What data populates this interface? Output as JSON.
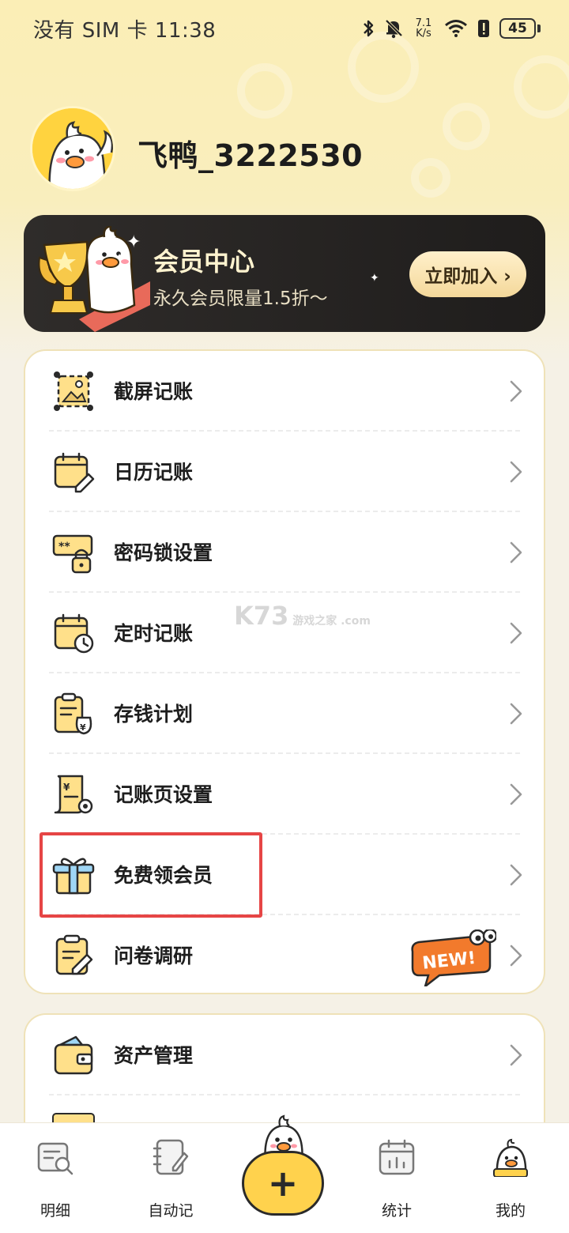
{
  "status_bar": {
    "left_text": "没有 SIM 卡 11:38",
    "net_speed_value": "7.1",
    "net_speed_unit": "K/s",
    "battery": "45",
    "icons": [
      "bluetooth-icon",
      "mute-bell-icon",
      "wifi-icon",
      "battery-alert-icon",
      "battery-icon"
    ]
  },
  "profile": {
    "username": "飞鸭_3222530"
  },
  "vip_card": {
    "title": "会员中心",
    "subtitle": "永久会员限量1.5折～",
    "button": "立即加入 ›"
  },
  "menu": {
    "items": [
      {
        "label": "截屏记账",
        "icon": "screenshot-icon"
      },
      {
        "label": "日历记账",
        "icon": "calendar-edit-icon"
      },
      {
        "label": "密码锁设置",
        "icon": "password-lock-icon"
      },
      {
        "label": "定时记账",
        "icon": "calendar-clock-icon"
      },
      {
        "label": "存钱计划",
        "icon": "savings-plan-icon"
      },
      {
        "label": "记账页设置",
        "icon": "bill-settings-icon"
      },
      {
        "label": "免费领会员",
        "icon": "gift-icon"
      },
      {
        "label": "问卷调研",
        "icon": "survey-icon",
        "badge": "NEW!"
      }
    ]
  },
  "menu2": {
    "items": [
      {
        "label": "资产管理",
        "icon": "wallet-icon"
      }
    ]
  },
  "watermark": {
    "main": "K73",
    "sub": "游戏之家",
    "domain": ".com"
  },
  "bottom_nav": {
    "items": [
      {
        "label": "明细",
        "icon": "detail-icon"
      },
      {
        "label": "自动记",
        "icon": "auto-record-icon"
      },
      {
        "label": "统计",
        "icon": "statistics-icon"
      },
      {
        "label": "我的",
        "icon": "profile-duck-icon"
      }
    ],
    "fab": "+"
  },
  "colors": {
    "accent": "#ffd24d",
    "highlight": "#e64545",
    "vip_bg": "#2a2826"
  }
}
